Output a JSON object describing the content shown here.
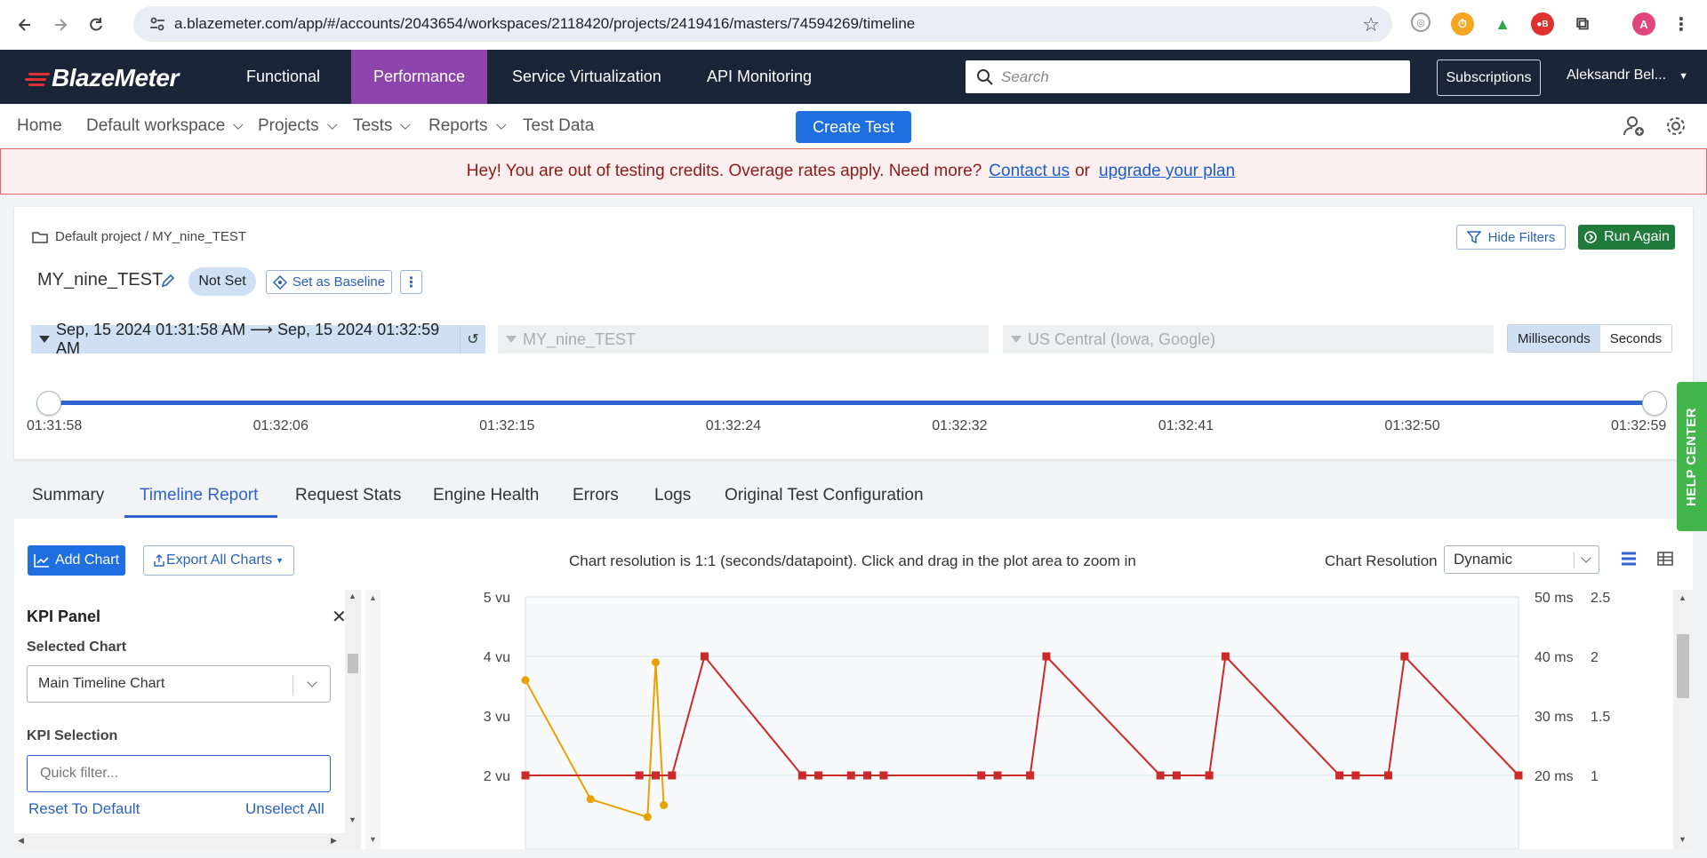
{
  "browser": {
    "url": "a.blazemeter.com/app/#/accounts/2043654/workspaces/2118420/projects/2419416/masters/74594269/timeline",
    "profile_initial": "A"
  },
  "header": {
    "logo": "BlazeMeter",
    "tabs": [
      "Functional",
      "Performance",
      "Service Virtualization",
      "API Monitoring"
    ],
    "active_tab": "Performance",
    "search_placeholder": "Search",
    "subscriptions": "Subscriptions",
    "user": "Aleksandr Bel..."
  },
  "subnav": {
    "home": "Home",
    "workspace": "Default workspace",
    "projects": "Projects",
    "tests": "Tests",
    "reports": "Reports",
    "test_data": "Test Data",
    "create_test": "Create Test"
  },
  "banner": {
    "text": "Hey! You are out of testing credits. Overage rates apply. Need more?",
    "contact": "Contact us",
    "or": "or",
    "upgrade": "upgrade your plan"
  },
  "test": {
    "breadcrumb": "Default project / MY_nine_TEST",
    "hide_filters": "Hide Filters",
    "run_again": "Run Again",
    "title": "MY_nine_TEST",
    "baseline_status": "Not Set",
    "set_baseline": "Set as Baseline",
    "date_range": "Sep, 15 2024 01:31:58 AM ⟶ Sep, 15 2024 01:32:59 AM",
    "scenario": "MY_nine_TEST",
    "location": "US Central (Iowa, Google)",
    "unit_ms": "Milliseconds",
    "unit_s": "Seconds",
    "active_unit": "Milliseconds",
    "slider_ticks": [
      "01:31:58",
      "01:32:06",
      "01:32:15",
      "01:32:24",
      "01:32:32",
      "01:32:41",
      "01:32:50",
      "01:32:59"
    ],
    "slider_selection": [
      0,
      1
    ]
  },
  "report_tabs": [
    "Summary",
    "Timeline Report",
    "Request Stats",
    "Engine Health",
    "Errors",
    "Logs",
    "Original Test Configuration"
  ],
  "active_report_tab": "Timeline Report",
  "toolbar": {
    "add_chart": "Add Chart",
    "export": "Export All Charts",
    "resolution_note": "Chart resolution is 1:1 (seconds/datapoint). Click and drag in the plot area to zoom in",
    "resolution_label": "Chart Resolution",
    "resolution_value": "Dynamic"
  },
  "kpi": {
    "title": "KPI Panel",
    "selected_chart_label": "Selected Chart",
    "selected_chart": "Main Timeline Chart",
    "kpi_selection_label": "KPI Selection",
    "filter_placeholder": "Quick filter...",
    "reset": "Reset To Default",
    "unselect": "Unselect All"
  },
  "help_center": "HELP CENTER",
  "chart_data": {
    "type": "line",
    "y_left_ticks": [
      "5 vu",
      "4 vu",
      "3 vu",
      "2 vu"
    ],
    "y_mid_ticks": [
      "50 ms",
      "40 ms",
      "30 ms",
      "20 ms"
    ],
    "y_right_ticks": [
      "2.5",
      "2",
      "1.5",
      "1"
    ],
    "ylim_vu": [
      2,
      5
    ],
    "grid": true,
    "x": [
      0,
      7,
      8,
      9,
      11,
      17,
      18,
      20,
      21,
      22,
      28,
      29,
      31,
      32,
      39,
      40,
      42,
      43,
      50,
      51,
      53,
      54,
      61
    ],
    "series": [
      {
        "color": "#cc2929",
        "values": [
          2,
          2,
          2,
          2,
          4,
          2,
          2,
          2,
          2,
          2,
          2,
          2,
          2,
          4,
          2,
          2,
          2,
          4,
          2,
          2,
          2,
          4,
          2
        ]
      },
      {
        "color": "#e8a200",
        "x": [
          0,
          4,
          7.5,
          8,
          8.5
        ],
        "values": [
          3.6,
          1.6,
          1.3,
          3.9,
          1.5
        ]
      }
    ]
  }
}
